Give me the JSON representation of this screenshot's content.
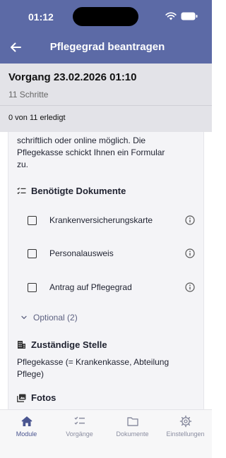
{
  "status_bar": {
    "time": "01:12"
  },
  "nav": {
    "title": "Pflegegrad beantragen"
  },
  "summary": {
    "title": "Vorgang 23.02.2026 01:10",
    "steps": "11 Schritte",
    "progress": "0 von 11 erledigt"
  },
  "card": {
    "intro_line1": "schriftlich oder online möglich. Die",
    "intro_line2": "Pflegekasse schickt Ihnen ein Formular",
    "intro_line3": "zu.",
    "documents_title": "Benötigte Dokumente",
    "documents": [
      {
        "label": "Krankenversicherungskarte",
        "checked": false
      },
      {
        "label": "Personalausweis",
        "checked": false
      },
      {
        "label": "Antrag auf Pflegegrad",
        "checked": false
      }
    ],
    "optional_label": "Optional (2)",
    "stelle_title": "Zuständige Stelle",
    "stelle_line1": "Pflegekasse (= Krankenkasse, Abteilung",
    "stelle_line2": "Pflege)",
    "fotos_title": "Fotos"
  },
  "tabs": [
    {
      "label": "Module",
      "icon": "home-icon",
      "active": true
    },
    {
      "label": "Vorgänge",
      "icon": "checklist-icon",
      "active": false
    },
    {
      "label": "Dokumente",
      "icon": "folder-icon",
      "active": false
    },
    {
      "label": "Einstellungen",
      "icon": "gear-icon",
      "active": false
    }
  ],
  "colors": {
    "header": "#5c6aa6",
    "summary_bg": "#e3e3e8",
    "card_bg": "#f4f4f7",
    "active_tab": "#4a5590"
  }
}
